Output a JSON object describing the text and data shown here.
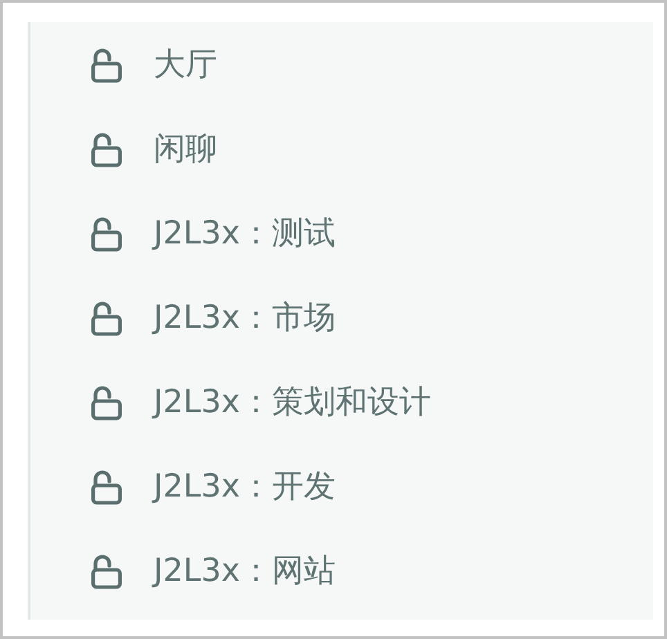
{
  "channels": [
    {
      "label": "大厅"
    },
    {
      "label": "闲聊"
    },
    {
      "label": "J2L3x：测试"
    },
    {
      "label": "J2L3x：市场"
    },
    {
      "label": "J2L3x：策划和设计"
    },
    {
      "label": "J2L3x：开发"
    },
    {
      "label": "J2L3x：网站"
    }
  ]
}
